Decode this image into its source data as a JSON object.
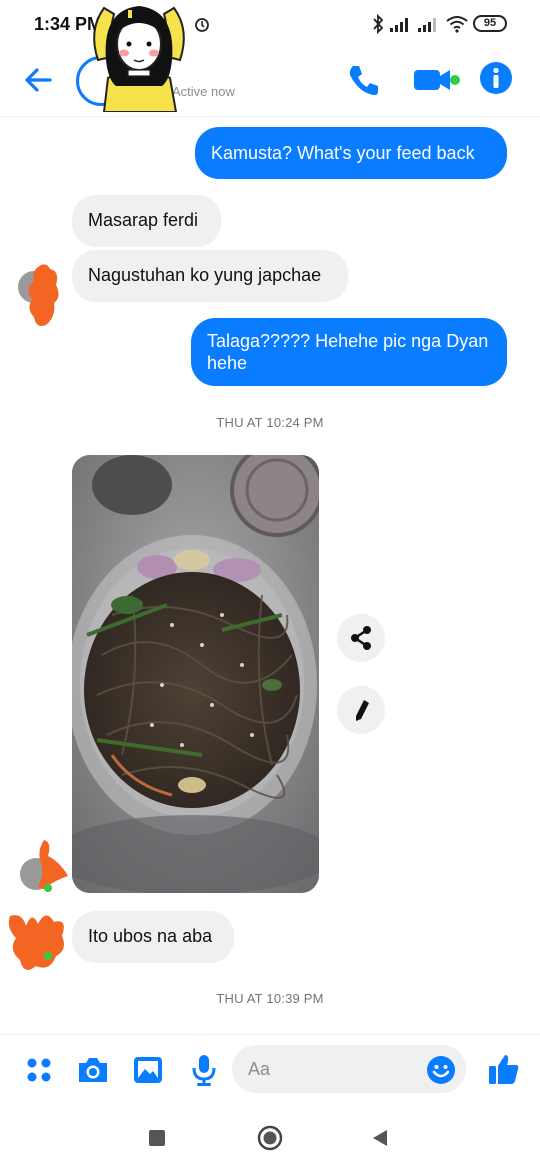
{
  "status_bar": {
    "time": "1:34 PM",
    "battery": "95"
  },
  "header": {
    "active_status": "Active now"
  },
  "messages": [
    {
      "text": "Kamusta? What's your feed back"
    },
    {
      "text": "Masarap ferdi"
    },
    {
      "text": "Nagustuhan ko yung japchae"
    },
    {
      "text": "Talaga????? Hehehe pic nga Dyan hehe"
    },
    {
      "text": "Ito ubos na aba"
    }
  ],
  "timestamps": [
    "THU AT 10:24 PM",
    "THU AT 10:39 PM"
  ],
  "composer": {
    "placeholder": "Aa"
  },
  "colors": {
    "accent": "#0a7cff",
    "incoming_bubble": "#f0f0f0",
    "avatar_scribble": "#f26522"
  }
}
